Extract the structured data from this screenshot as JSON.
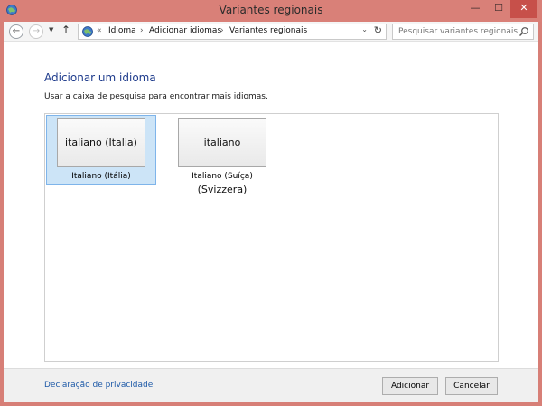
{
  "window": {
    "title": "Variantes regionais",
    "min_glyph": "—",
    "max_glyph": "☐",
    "close_glyph": "✕"
  },
  "nav": {
    "back_glyph": "←",
    "forward_glyph": "→",
    "recent_glyph": "▼",
    "up_glyph": "↑"
  },
  "address": {
    "overflow": "«",
    "separator": "›",
    "crumbs": [
      "Idioma",
      "Adicionar idiomas",
      "Variantes regionais"
    ],
    "dropdown_glyph": "⌄",
    "refresh_glyph": "↻"
  },
  "search": {
    "placeholder": "Pesquisar variantes regionais"
  },
  "main": {
    "heading": "Adicionar um idioma",
    "hint": "Usar a caixa de pesquisa para encontrar mais idiomas."
  },
  "variants": [
    {
      "native": "italiano (Italia)",
      "caption": "Italiano (Itália)",
      "selected": true
    },
    {
      "native": "italiano (Svizzera)",
      "caption": "Italiano (Suíça)",
      "selected": false
    }
  ],
  "footer": {
    "privacy_link": "Declaração de privacidade",
    "add_label": "Adicionar",
    "cancel_label": "Cancelar"
  },
  "colors": {
    "titlebar": "#d98078",
    "heading": "#1e3b8c",
    "link": "#1e5aa8",
    "selection_bg": "#cce4f7",
    "selection_border": "#7eb4ea"
  }
}
